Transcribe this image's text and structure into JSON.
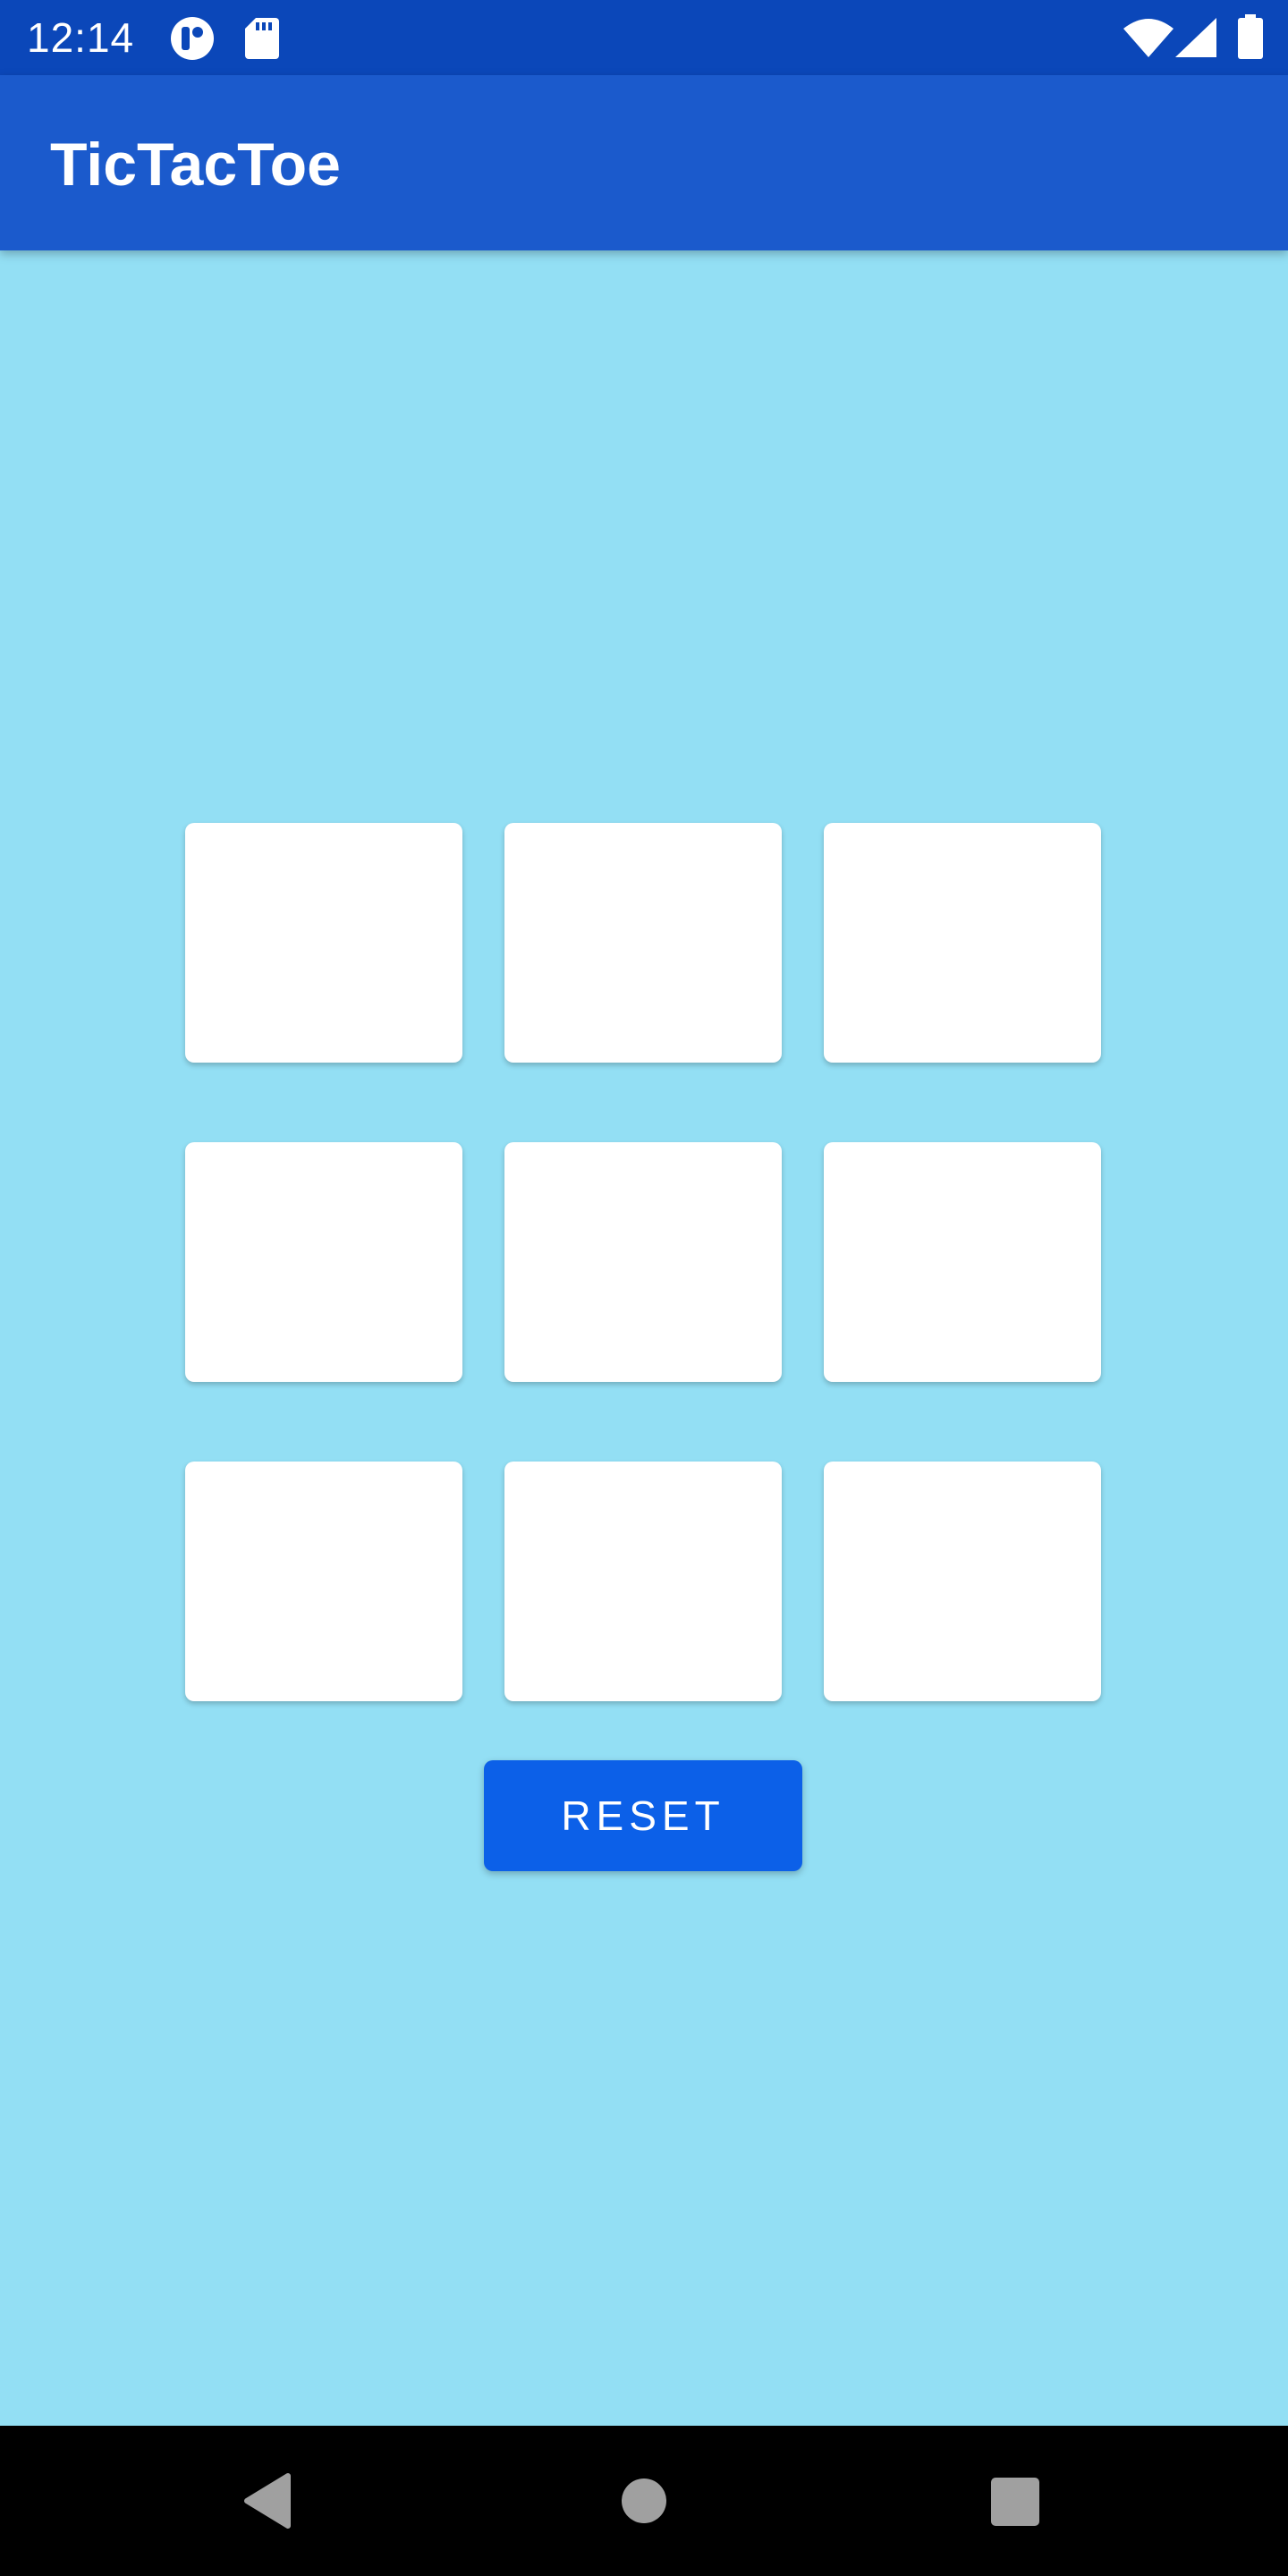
{
  "status_bar": {
    "time": "12:14",
    "icons": [
      "app-notification-icon",
      "sd-card-icon",
      "wifi-icon",
      "cell-signal-icon",
      "battery-icon"
    ]
  },
  "app_bar": {
    "title": "TicTacToe"
  },
  "board": {
    "rows": [
      [
        "",
        "",
        ""
      ],
      [
        "",
        "",
        ""
      ],
      [
        "",
        "",
        ""
      ]
    ]
  },
  "reset_button": {
    "label": "RESET"
  },
  "nav_bar": {
    "buttons": [
      "back-icon",
      "home-icon",
      "recents-icon"
    ]
  },
  "colors": {
    "status_bar": "#0b47b9",
    "app_bar": "#1b5acc",
    "background": "#93dff4",
    "cell": "#ffffff",
    "button": "#0c60e8",
    "nav_bar": "#000000",
    "nav_icons": "#a0a0a0"
  }
}
